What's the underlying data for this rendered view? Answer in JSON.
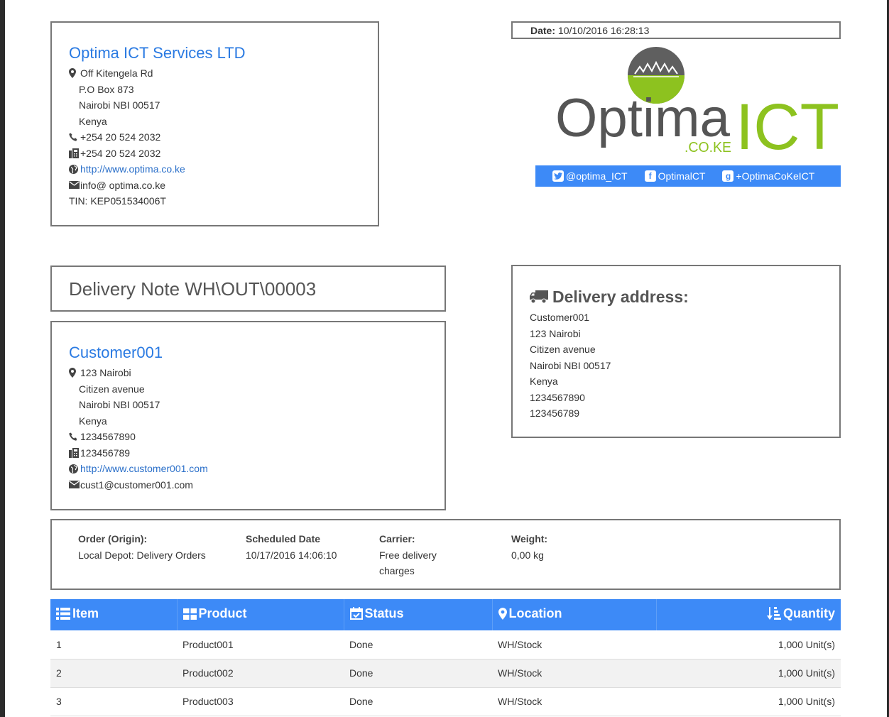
{
  "company": {
    "name": "Optima ICT Services LTD",
    "address": [
      "Off Kitengela Rd",
      "P.O Box 873",
      "Nairobi NBI 00517",
      "Kenya"
    ],
    "phone": "+254 20 524 2032",
    "fax": "+254 20 524 2032",
    "website": "http://www.optima.co.ke",
    "email": "info@ optima.co.ke",
    "tin": "TIN: KEP051534006T"
  },
  "date": {
    "label": "Date:",
    "value": "10/10/2016 16:28:13"
  },
  "logo": {
    "word1": "Optima",
    "word2": "ICT",
    "sub": ".CO.KE",
    "color_dark": "#555555",
    "color_green": "#8dc21f"
  },
  "social": {
    "twitter": "@optima_ICT",
    "facebook": "OptimalCT",
    "google": "+OptimaCoKeICT"
  },
  "document": {
    "title": "Delivery Note WH\\OUT\\00003"
  },
  "customer": {
    "name": "Customer001",
    "address": [
      "123 Nairobi",
      "Citizen avenue",
      "Nairobi NBI 00517",
      "Kenya"
    ],
    "phone": "1234567890",
    "fax": "123456789",
    "website": "http://www.customer001.com",
    "email": "cust1@customer001.com"
  },
  "delivery": {
    "heading": "Delivery address:",
    "lines": [
      "Customer001",
      "123 Nairobi",
      "Citizen avenue",
      "Nairobi NBI 00517",
      "Kenya",
      "1234567890",
      "123456789"
    ]
  },
  "info": {
    "order_label": "Order (Origin):",
    "order_value": "Local Depot: Delivery Orders",
    "date_label": "Scheduled Date",
    "date_value": "10/17/2016 14:06:10",
    "carrier_label": "Carrier:",
    "carrier_value1": "Free delivery",
    "carrier_value2": "charges",
    "weight_label": "Weight:",
    "weight_value": "0,00 kg"
  },
  "table": {
    "headers": {
      "item": "Item",
      "product": "Product",
      "status": "Status",
      "location": "Location",
      "quantity": "Quantity"
    },
    "rows": [
      {
        "item": "1",
        "product": "Product001",
        "status": "Done",
        "location": "WH/Stock",
        "quantity": "1,000 Unit(s)"
      },
      {
        "item": "2",
        "product": "Product002",
        "status": "Done",
        "location": "WH/Stock",
        "quantity": "1,000 Unit(s)"
      },
      {
        "item": "3",
        "product": "Product003",
        "status": "Done",
        "location": "WH/Stock",
        "quantity": "1,000 Unit(s)"
      }
    ]
  },
  "colors": {
    "accent": "#3d8af7",
    "link": "#2a7ae2",
    "border": "#777777"
  }
}
